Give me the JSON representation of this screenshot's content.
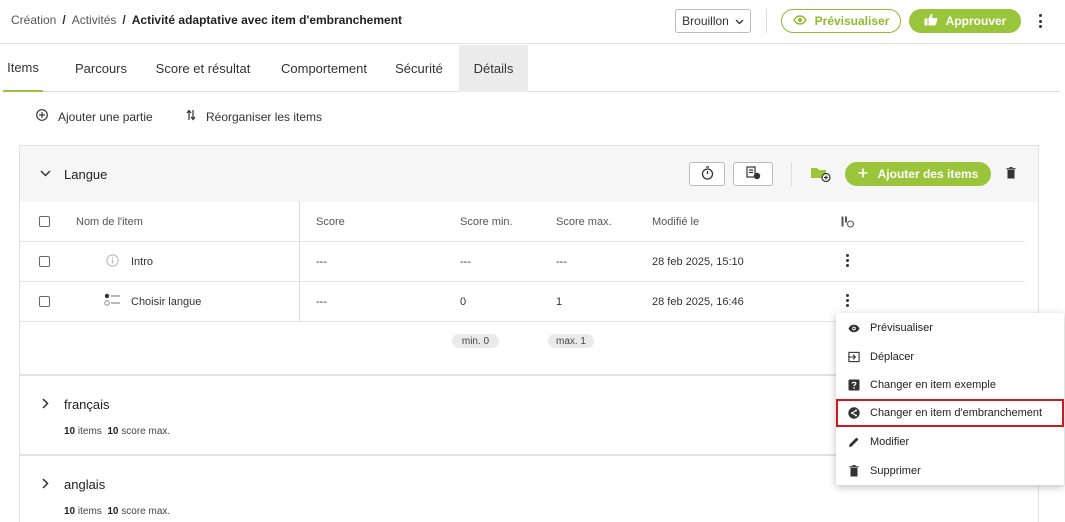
{
  "breadcrumb": {
    "items": [
      "Création",
      "Activités"
    ],
    "separator": "/",
    "current": "Activité adaptative avec item d'embranchement"
  },
  "header": {
    "status_select": "Brouillon",
    "preview_label": "Prévisualiser",
    "approve_label": "Approuver"
  },
  "tabs": [
    {
      "label": "Items",
      "active": true
    },
    {
      "label": "Parcours"
    },
    {
      "label": "Score et résultat"
    },
    {
      "label": "Comportement"
    },
    {
      "label": "Sécurité"
    },
    {
      "label": "Détails"
    }
  ],
  "toolbar": {
    "add_part": "Ajouter une partie",
    "reorder": "Réorganiser les items"
  },
  "section": {
    "title": "Langue",
    "add_items": "Ajouter des items",
    "columns": {
      "name": "Nom de l'item",
      "score": "Score",
      "score_min": "Score min.",
      "score_max": "Score max.",
      "modified": "Modifié le"
    },
    "rows": [
      {
        "name": "Intro",
        "score": "---",
        "score_min": "---",
        "score_max": "---",
        "modified": "28 feb 2025, 15:10"
      },
      {
        "name": "Choisir langue",
        "score": "---",
        "score_min": "0",
        "score_max": "1",
        "modified": "28 feb 2025, 16:46"
      }
    ],
    "min_pill": "min. 0",
    "max_pill": "max. 1"
  },
  "parts": [
    {
      "title": "français",
      "items_count": "10",
      "items_label": "items",
      "score_max": "10",
      "score_label": "score max."
    },
    {
      "title": "anglais",
      "items_count": "10",
      "items_label": "items",
      "score_max": "10",
      "score_label": "score max."
    }
  ],
  "context_menu": {
    "items": [
      {
        "label": "Prévisualiser",
        "icon": "eye-icon"
      },
      {
        "label": "Déplacer",
        "icon": "move-icon"
      },
      {
        "label": "Changer en item exemple",
        "icon": "question-icon"
      },
      {
        "label": "Changer en item d'embranchement",
        "icon": "branch-icon",
        "highlighted": true
      },
      {
        "label": "Modifier",
        "icon": "pencil-icon"
      },
      {
        "label": "Supprimer",
        "icon": "trash-icon"
      }
    ]
  },
  "colors": {
    "accent": "#9ac53a",
    "highlight_border": "#d0191c"
  }
}
